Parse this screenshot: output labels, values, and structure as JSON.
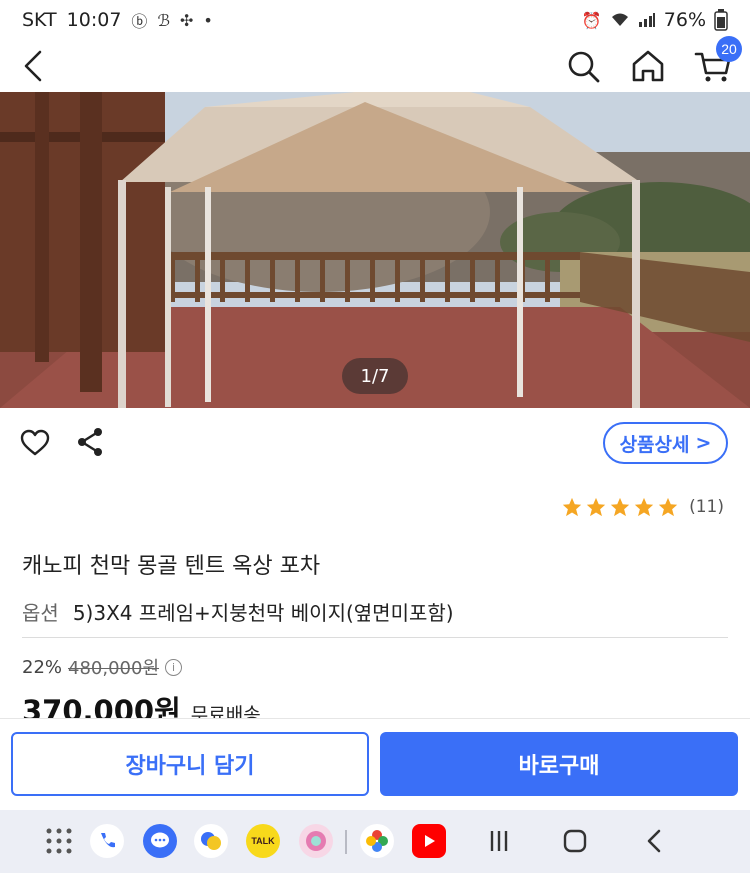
{
  "status_bar": {
    "carrier": "SKT",
    "time": "10:07",
    "battery": "76%"
  },
  "app_bar": {
    "cart_count": "20"
  },
  "gallery": {
    "page_indicator": "1/7"
  },
  "actions": {
    "detail_button": "상품상세",
    "detail_chevron": ">"
  },
  "rating": {
    "stars": 5,
    "count": "(11)",
    "star_color": "#f5a623"
  },
  "product": {
    "title": "캐노피 천막 몽골 텐트 옥상 포차",
    "option_label": "옵션",
    "option_value": "5)3X4 프레임+지붕천막 베이지(옆면미포함)"
  },
  "price": {
    "discount": "22%",
    "original": "480,000원",
    "sale": "370.000원",
    "shipping": "무료배송"
  },
  "bottom_actions": {
    "cart_button": "장바구니 담기",
    "buy_button": "바로구매"
  },
  "theme": {
    "accent": "#3a6ff7"
  },
  "nav_bar": {
    "kakao_label": "TALK"
  }
}
